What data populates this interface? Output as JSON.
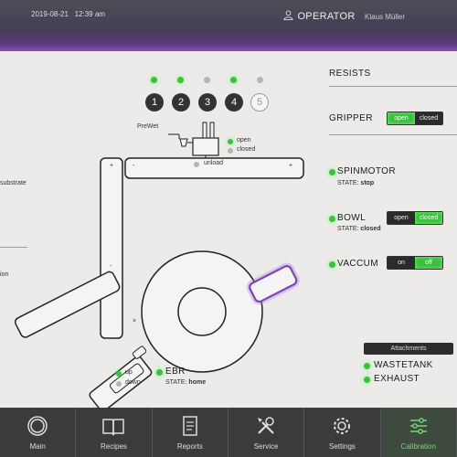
{
  "header": {
    "date": "2019-08-21",
    "time": "12:39 am",
    "role": "OPERATOR",
    "user": "Klaus Müller"
  },
  "steps": [
    "1",
    "2",
    "3",
    "4",
    "5"
  ],
  "diagram": {
    "prewet": "PreWet",
    "open": "open",
    "closed": "closed",
    "unload": "unload",
    "plus": "+",
    "minus": "-",
    "x": "×",
    "left_substrate": "substrate",
    "left_ion": "ion"
  },
  "ebr": {
    "name": "EBR",
    "state_label": "STATE:",
    "state_value": "home",
    "up": "up",
    "down": "down"
  },
  "right": {
    "resists": "RESISTS",
    "gripper": {
      "label": "GRIPPER",
      "open": "open",
      "closed": "closed"
    },
    "spinmotor": {
      "label": "SPINMOTOR",
      "state_label": "STATE:",
      "state_value": "stop"
    },
    "bowl": {
      "label": "BOWL",
      "state_label": "STATE:",
      "state_value": "closed",
      "open": "open",
      "closed": "closed"
    },
    "vaccum": {
      "label": "VACCUM",
      "on": "on",
      "off": "off"
    }
  },
  "attachments": {
    "title": "Attachments",
    "items": [
      "WASTETANK",
      "EXHAUST"
    ]
  },
  "nav": [
    {
      "label": "Main",
      "icon": "circle-icon"
    },
    {
      "label": "Recipes",
      "icon": "book-icon"
    },
    {
      "label": "Reports",
      "icon": "document-icon"
    },
    {
      "label": "Service",
      "icon": "tools-icon"
    },
    {
      "label": "Settings",
      "icon": "gear-icon"
    },
    {
      "label": "Calibration",
      "icon": "sliders-icon"
    }
  ],
  "colors": {
    "accent_green": "#3cbd3c",
    "accent_purple": "#8a4fb8"
  }
}
